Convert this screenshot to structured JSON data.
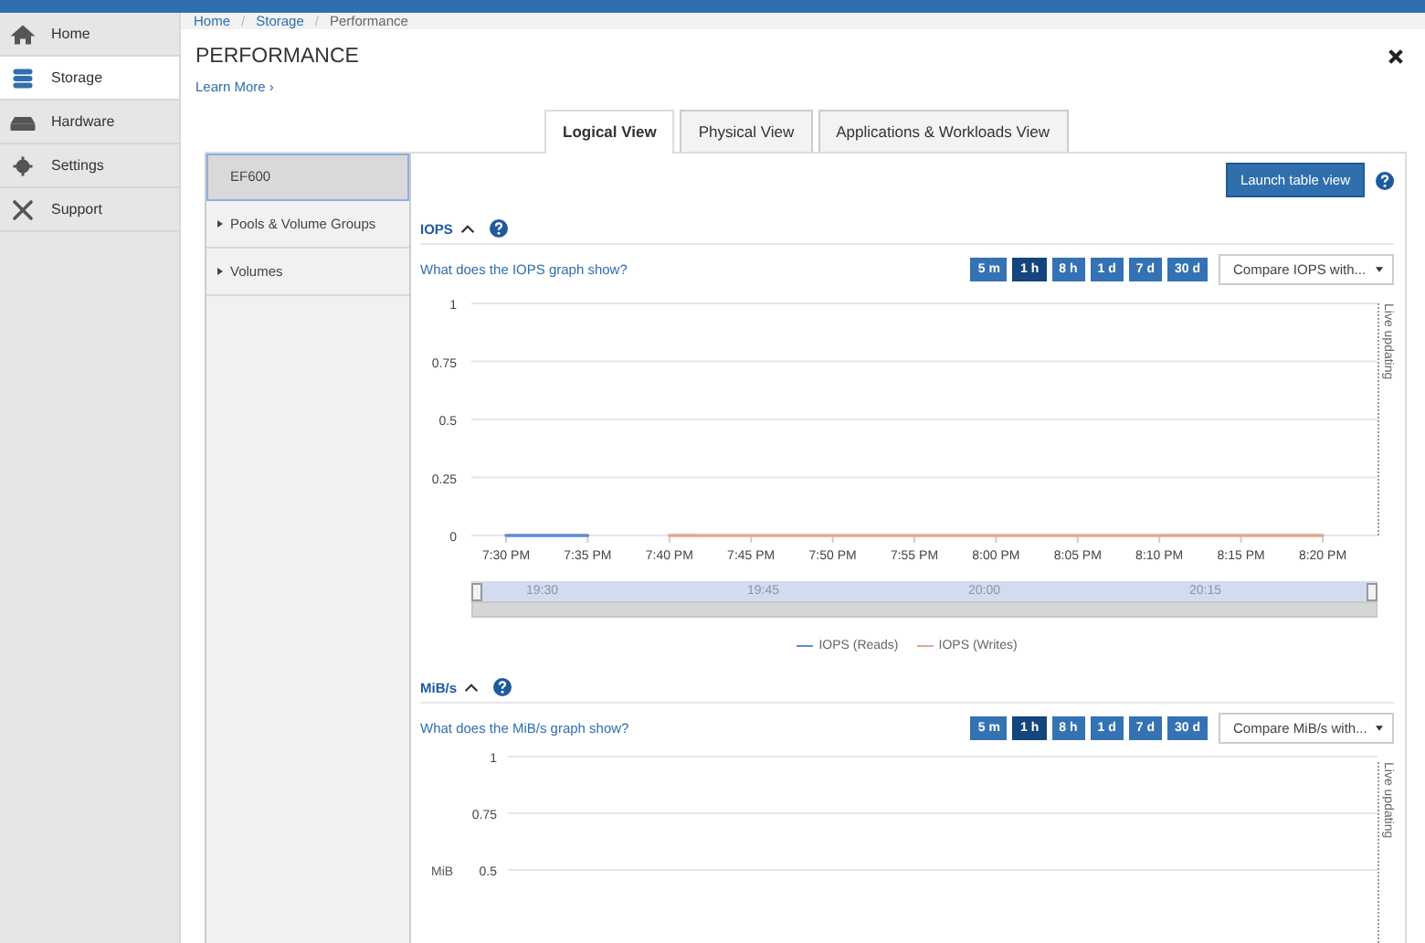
{
  "sidebar": {
    "items": [
      {
        "label": "Home",
        "selected": false
      },
      {
        "label": "Storage",
        "selected": true
      },
      {
        "label": "Hardware",
        "selected": false
      },
      {
        "label": "Settings",
        "selected": false
      },
      {
        "label": "Support",
        "selected": false
      }
    ]
  },
  "breadcrumb": {
    "items": [
      {
        "label": "Home",
        "current": false
      },
      {
        "label": "Storage",
        "current": false
      },
      {
        "label": "Performance",
        "current": true
      }
    ],
    "separators": [
      "/",
      "/"
    ]
  },
  "page": {
    "title": "PERFORMANCE",
    "learn_more": "Learn More ›"
  },
  "tabs": [
    {
      "label": "Logical View",
      "selected": true
    },
    {
      "label": "Physical View",
      "selected": false
    },
    {
      "label": "Applications & Workloads View",
      "selected": false
    }
  ],
  "tree": {
    "label": "EF600",
    "selected": true,
    "children": [
      {
        "label": "Pools & Volume Groups",
        "expanded": false,
        "selected": false
      },
      {
        "label": "Volumes",
        "expanded": false,
        "selected": false
      }
    ]
  },
  "launch_button": "Launch table view",
  "sections": [
    {
      "title": "IOPS",
      "expanded": true,
      "help_link": "What does the IOPS graph show?",
      "ranges": [
        {
          "label": "5 m",
          "selected": false
        },
        {
          "label": "1 h",
          "selected": true
        },
        {
          "label": "8 h",
          "selected": false
        },
        {
          "label": "1 d",
          "selected": false
        },
        {
          "label": "7 d",
          "selected": false
        },
        {
          "label": "30 d",
          "selected": false
        }
      ],
      "compare": {
        "placeholder": "Compare IOPS with..."
      },
      "live_label": "Live updating",
      "chart_data": {
        "type": "line",
        "grid": true,
        "categories": [
          "7:30 PM",
          "7:35 PM",
          "7:40 PM",
          "7:45 PM",
          "7:50 PM",
          "7:55 PM",
          "8:00 PM",
          "8:05 PM",
          "8:10 PM",
          "8:15 PM",
          "8:20 PM"
        ],
        "yticks": [
          0,
          0.25,
          0.5,
          0.75,
          1
        ],
        "ylim": [
          0,
          1
        ],
        "series": [
          {
            "name": "IOPS (Reads)",
            "color": "#5b8fd0",
            "values": [
              0,
              0,
              null,
              null,
              null,
              null,
              null,
              null,
              null,
              null,
              null
            ]
          },
          {
            "name": "IOPS (Writes)",
            "color": "#e0a890",
            "values": [
              null,
              null,
              0,
              0,
              0,
              0,
              0,
              0,
              0,
              0,
              0
            ]
          }
        ]
      },
      "navigator": [
        "19:30",
        "19:45",
        "20:00",
        "20:15"
      ]
    },
    {
      "title": "MiB/s",
      "expanded": true,
      "help_link": "What does the MiB/s graph show?",
      "ranges": [
        {
          "label": "5 m",
          "selected": false
        },
        {
          "label": "1 h",
          "selected": true
        },
        {
          "label": "8 h",
          "selected": false
        },
        {
          "label": "1 d",
          "selected": false
        },
        {
          "label": "7 d",
          "selected": false
        },
        {
          "label": "30 d",
          "selected": false
        }
      ],
      "compare": {
        "placeholder": "Compare MiB/s with..."
      },
      "live_label": "Live updating",
      "y_axis": {
        "label": "MiB",
        "ticks": [
          "1",
          "0.75",
          "0.5"
        ]
      }
    }
  ]
}
